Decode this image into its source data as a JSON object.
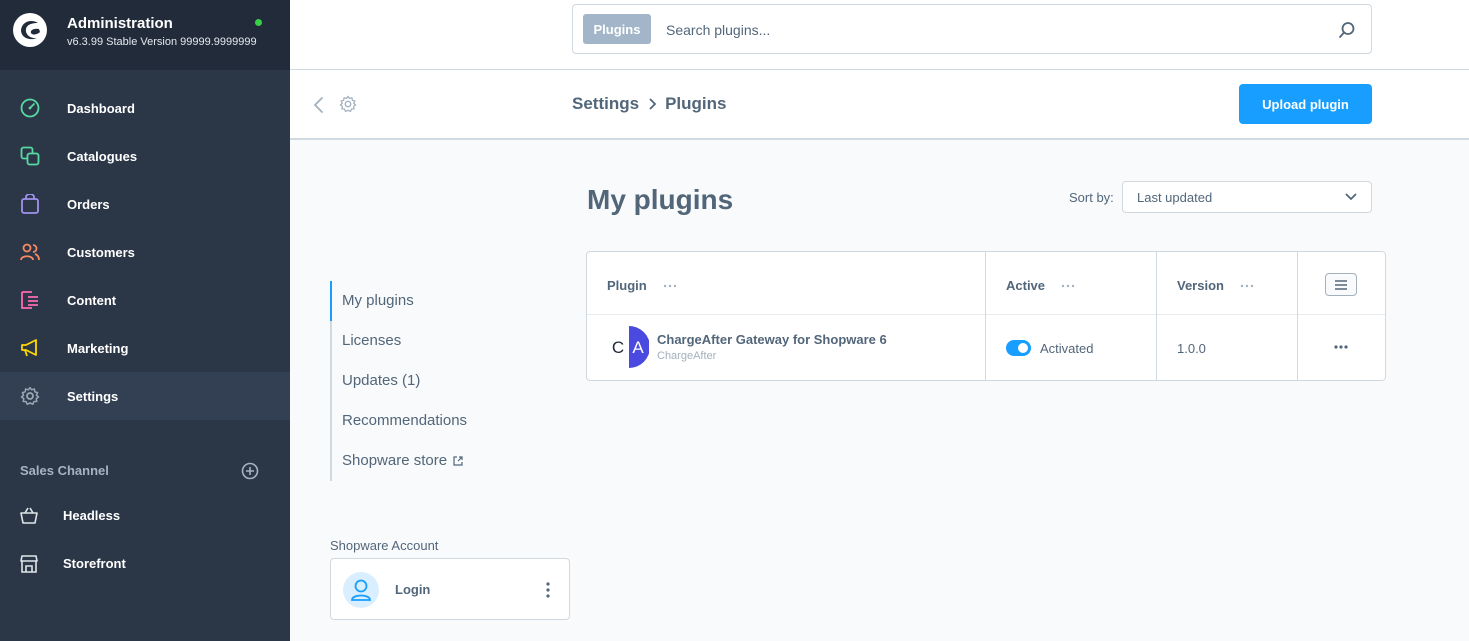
{
  "app": {
    "title": "Administration",
    "version": "v6.3.99 Stable Version 99999.9999999"
  },
  "nav": [
    {
      "label": "Dashboard",
      "icon": "dashboard-icon",
      "color": "#57d9a3"
    },
    {
      "label": "Catalogues",
      "icon": "catalogues-icon",
      "color": "#57d9a3"
    },
    {
      "label": "Orders",
      "icon": "orders-icon",
      "color": "#a092f0"
    },
    {
      "label": "Customers",
      "icon": "customers-icon",
      "color": "#f88962"
    },
    {
      "label": "Content",
      "icon": "content-icon",
      "color": "#ff68b4"
    },
    {
      "label": "Marketing",
      "icon": "marketing-icon",
      "color": "#ffd700"
    },
    {
      "label": "Settings",
      "icon": "settings-icon",
      "color": "#9aa8b5"
    }
  ],
  "sales_channel": {
    "title": "Sales Channel",
    "items": [
      {
        "label": "Headless",
        "icon": "basket-icon"
      },
      {
        "label": "Storefront",
        "icon": "storefront-icon"
      }
    ]
  },
  "search": {
    "type_label": "Plugins",
    "placeholder": "Search plugins..."
  },
  "breadcrumb": {
    "parent": "Settings",
    "current": "Plugins"
  },
  "upload_button": "Upload plugin",
  "side_tabs": [
    {
      "label": "My plugins",
      "active": true
    },
    {
      "label": "Licenses",
      "active": false
    },
    {
      "label": "Updates (1)",
      "active": false
    },
    {
      "label": "Recommendations",
      "active": false
    },
    {
      "label": "Shopware store",
      "active": false,
      "external": true
    }
  ],
  "account": {
    "label": "Shopware Account",
    "login": "Login"
  },
  "main": {
    "title": "My plugins",
    "sort_label": "Sort by:",
    "sort_value": "Last updated"
  },
  "grid": {
    "columns": [
      "Plugin",
      "Active",
      "Version"
    ],
    "rows": [
      {
        "logo_text": "C A",
        "name": "ChargeAfter Gateway for Shopware 6",
        "vendor": "ChargeAfter",
        "active": true,
        "active_label": "Activated",
        "version": "1.0.0"
      }
    ]
  },
  "colors": {
    "accent": "#189eff",
    "sidebar": "#2b3646",
    "status_online": "#37d046"
  }
}
